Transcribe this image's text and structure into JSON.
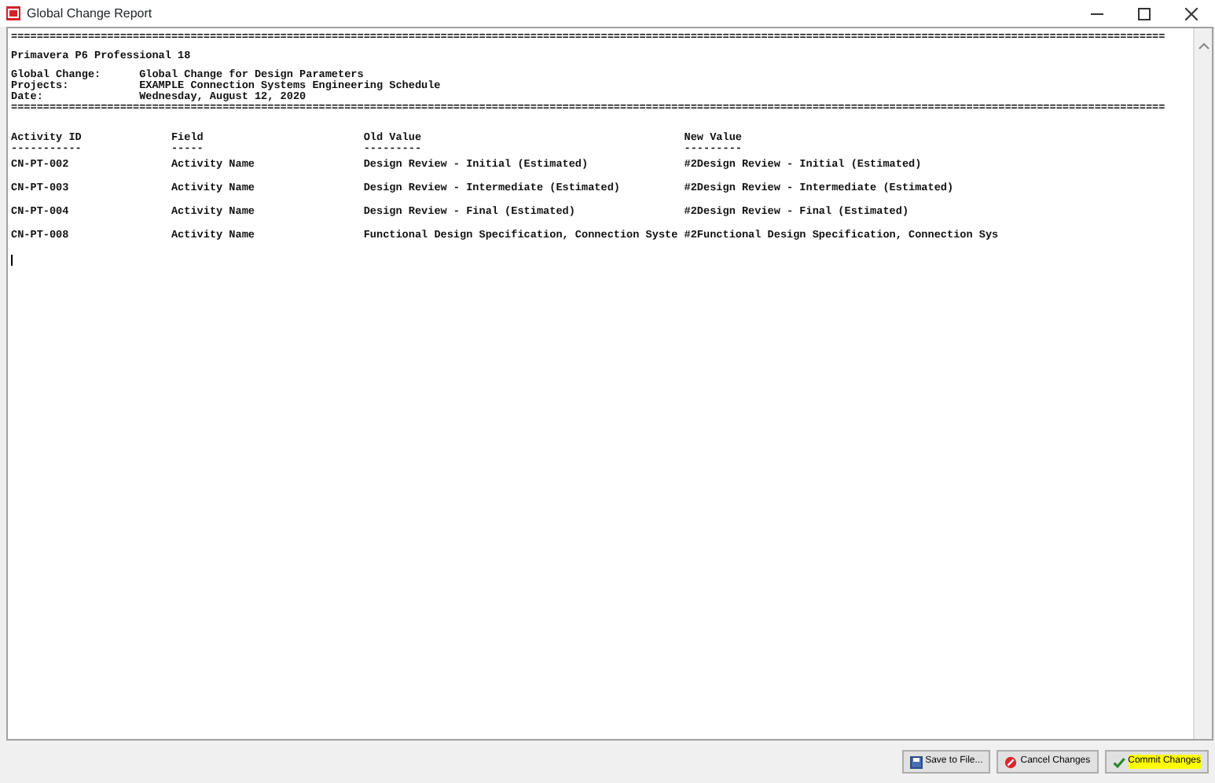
{
  "window": {
    "title": "Global Change Report"
  },
  "report": {
    "top_rule": "====================================================================================================================================================================================",
    "product": "Primavera P6 Professional 18",
    "info": [
      {
        "label": "Global Change:",
        "value": "Global Change for Design Parameters"
      },
      {
        "label": "Projects:",
        "value": "EXAMPLE Connection Systems Engineering Schedule"
      },
      {
        "label": "Date:",
        "value": "Wednesday, August 12, 2020"
      }
    ],
    "bottom_rule": "====================================================================================================================================================================================",
    "columns": [
      {
        "label": "Activity ID",
        "rule": "-----------"
      },
      {
        "label": "Field",
        "rule": "-----"
      },
      {
        "label": "Old Value",
        "rule": "---------"
      },
      {
        "label": "New Value",
        "rule": "---------"
      }
    ],
    "rows": [
      [
        "CN-PT-002",
        "Activity Name",
        "Design Review - Initial (Estimated)",
        "#2Design Review - Initial (Estimated)"
      ],
      [
        "CN-PT-003",
        "Activity Name",
        "Design Review - Intermediate (Estimated)",
        "#2Design Review - Intermediate (Estimated)"
      ],
      [
        "CN-PT-004",
        "Activity Name",
        "Design Review - Final (Estimated)",
        "#2Design Review - Final (Estimated)"
      ],
      [
        "CN-PT-008",
        "Activity Name",
        "Functional Design Specification, Connection Syste",
        "#2Functional Design Specification, Connection Sys"
      ]
    ]
  },
  "buttons": [
    {
      "label": "Save to File...",
      "kind": "save",
      "highlighted": false
    },
    {
      "label": "Cancel Changes",
      "kind": "cancel",
      "highlighted": false
    },
    {
      "label": "Commit Changes",
      "kind": "commit",
      "highlighted": true
    }
  ]
}
